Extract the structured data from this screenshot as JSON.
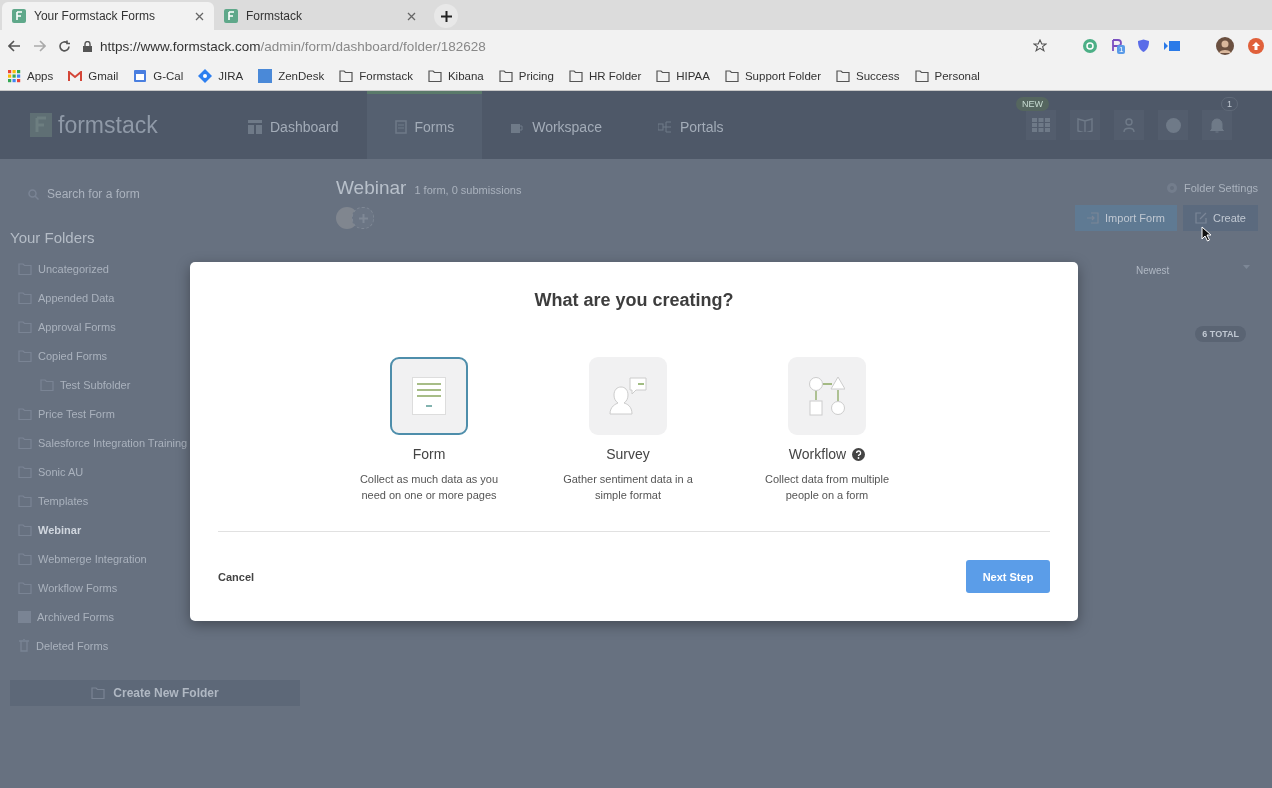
{
  "browser": {
    "tabs": [
      {
        "title": "Your Formstack Forms",
        "selected": true
      },
      {
        "title": "Formstack",
        "selected": false
      }
    ],
    "url": {
      "host": "https://www.formstack.com",
      "path": "/admin/form/dashboard/folder/182628"
    },
    "extension_badge": "1",
    "bookmarks": [
      {
        "label": "Apps",
        "kind": "apps"
      },
      {
        "label": "Gmail",
        "kind": "gmail"
      },
      {
        "label": "G-Cal",
        "kind": "calendar"
      },
      {
        "label": "JIRA",
        "kind": "jira"
      },
      {
        "label": "ZenDesk",
        "kind": "zendesk"
      },
      {
        "label": "Formstack",
        "kind": "folder"
      },
      {
        "label": "Kibana",
        "kind": "folder"
      },
      {
        "label": "Pricing",
        "kind": "folder"
      },
      {
        "label": "HR Folder",
        "kind": "folder"
      },
      {
        "label": "HIPAA",
        "kind": "folder"
      },
      {
        "label": "Support Folder",
        "kind": "folder"
      },
      {
        "label": "Success",
        "kind": "folder"
      },
      {
        "label": "Personal",
        "kind": "folder"
      }
    ]
  },
  "app": {
    "nav": {
      "logo": "formstack",
      "items": [
        {
          "label": "Dashboard",
          "kind": "dashboard",
          "selected": false
        },
        {
          "label": "Forms",
          "kind": "forms",
          "selected": true
        },
        {
          "label": "Workspace",
          "kind": "workspace",
          "selected": false
        },
        {
          "label": "Portals",
          "kind": "portals",
          "selected": false
        }
      ],
      "new_badge": "NEW",
      "notification_count": "1"
    },
    "sidebar": {
      "search_placeholder": "Search for a form",
      "heading": "Your Folders",
      "folders": [
        {
          "name": "Uncategorized",
          "kind": "folder",
          "selected": false
        },
        {
          "name": "Appended Data",
          "kind": "folder",
          "selected": false
        },
        {
          "name": "Approval Forms",
          "kind": "folder",
          "selected": false
        },
        {
          "name": "Copied Forms",
          "kind": "folder",
          "selected": false,
          "children": [
            {
              "name": "Test Subfolder",
              "kind": "folder",
              "selected": false
            }
          ]
        },
        {
          "name": "Price Test Form",
          "kind": "folder",
          "selected": false
        },
        {
          "name": "Salesforce Integration Training",
          "kind": "folder",
          "selected": false
        },
        {
          "name": "Sonic AU",
          "kind": "folder",
          "selected": false
        },
        {
          "name": "Templates",
          "kind": "folder",
          "selected": false
        },
        {
          "name": "Webinar",
          "kind": "folder",
          "selected": true
        },
        {
          "name": "Webmerge Integration",
          "kind": "folder",
          "selected": false
        },
        {
          "name": "Workflow Forms",
          "kind": "folder",
          "selected": false
        },
        {
          "name": "Archived Forms",
          "kind": "archive",
          "selected": false
        },
        {
          "name": "Deleted Forms",
          "kind": "trash",
          "selected": false
        }
      ],
      "create_button": "Create New Folder"
    },
    "main": {
      "title": "Webinar",
      "subtitle": "1 form, 0 submissions",
      "folder_settings": "Folder Settings",
      "buttons": [
        {
          "label": "Import Form",
          "kind": "import"
        },
        {
          "label": "Create",
          "kind": "create"
        }
      ],
      "sort_value": "Newest",
      "total": "6 TOTAL"
    }
  },
  "modal": {
    "title": "What are you creating?",
    "options": [
      {
        "title": "Form",
        "description": "Collect as much data as you need on one or more pages",
        "kind": "form",
        "selected": true,
        "help": false
      },
      {
        "title": "Survey",
        "description": "Gather sentiment data in a simple format",
        "kind": "survey",
        "selected": false,
        "help": false
      },
      {
        "title": "Workflow",
        "description": "Collect data from multiple people on a form",
        "kind": "workflow",
        "selected": false,
        "help": true
      }
    ],
    "cancel": "Cancel",
    "next": "Next Step"
  }
}
